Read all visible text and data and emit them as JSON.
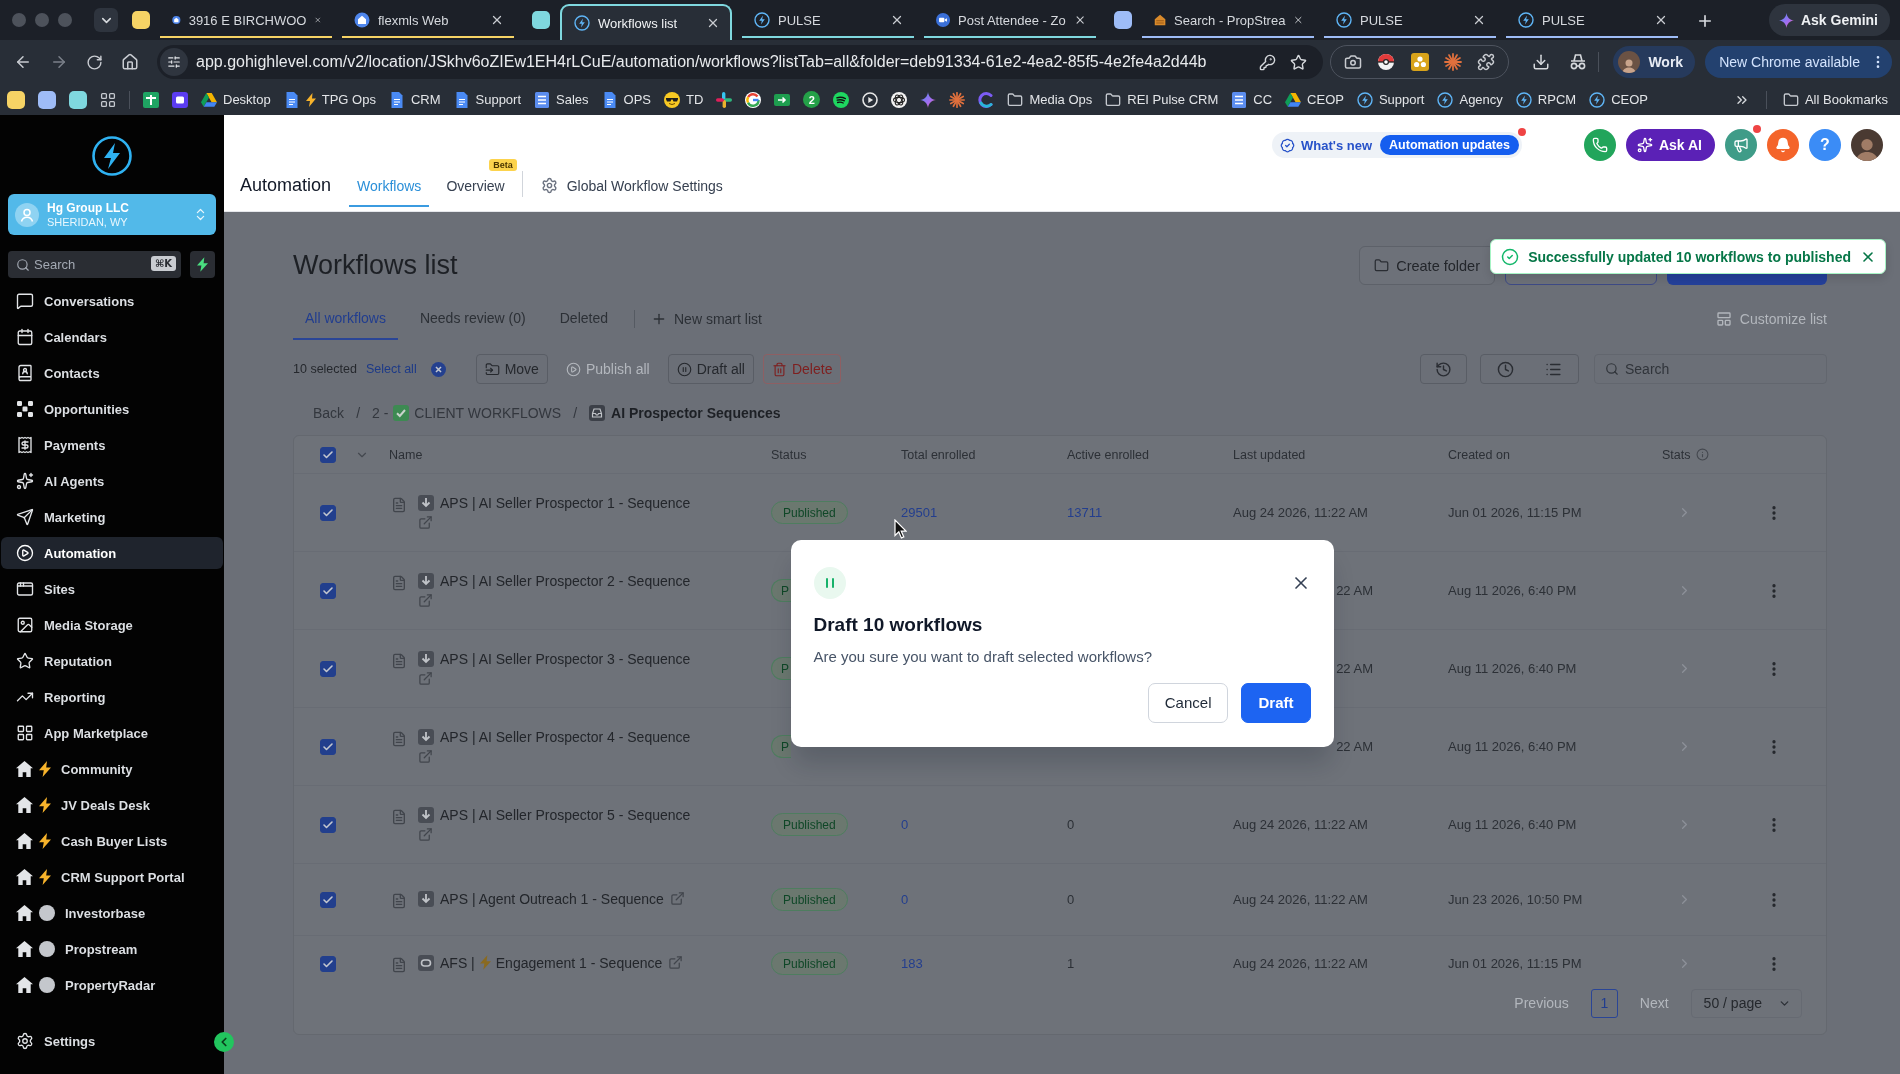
{
  "browser": {
    "tab_groups": [
      {
        "color": "#f6d365",
        "tabs": [
          {
            "kind": "pin",
            "title": "3916 E BIRCHWOO",
            "selected": false
          },
          {
            "kind": "pin",
            "title": "flexmls Web",
            "selected": false
          }
        ]
      },
      {
        "color": "#7fd8df",
        "tabs": [
          {
            "kind": "bolt",
            "title": "Workflows list",
            "selected": true
          },
          {
            "kind": "bolt",
            "title": "PULSE",
            "selected": false
          },
          {
            "kind": "round",
            "title": "Post Attendee - Zo",
            "selected": false
          }
        ]
      },
      {
        "color": "#9ebcf7",
        "tabs": [
          {
            "kind": "hut",
            "title": "Search - PropStrea",
            "selected": false
          },
          {
            "kind": "bolt",
            "title": "PULSE",
            "selected": false
          },
          {
            "kind": "bolt",
            "title": "PULSE",
            "selected": false
          }
        ]
      }
    ],
    "gemini_button": "Ask Gemini",
    "url": "app.gohighlevel.com/v2/location/JSkhv6oZIEw1EH4rLCuE/automation/workflows?listTab=all&folder=deb91334-61e2-4ea2-85f5-4e2fe4a2d44b",
    "profile": "Work",
    "update_button": "New Chrome available",
    "bookmarks": [
      {
        "kind": "tile",
        "color": "#f6d365"
      },
      {
        "kind": "tile",
        "color": "#9ebcf7"
      },
      {
        "kind": "tile",
        "color": "#7fd8df"
      },
      {
        "kind": "grid"
      },
      {
        "kind": "divider"
      },
      {
        "kind": "plus-tile"
      },
      {
        "kind": "app-tile"
      },
      {
        "kind": "drive",
        "label": "Desktop"
      },
      {
        "kind": "doc",
        "label": "TPG Ops",
        "bolt": true
      },
      {
        "kind": "doc",
        "label": "CRM"
      },
      {
        "kind": "doc",
        "label": "Support"
      },
      {
        "kind": "sheet",
        "label": "Sales"
      },
      {
        "kind": "doc",
        "label": "OPS"
      },
      {
        "kind": "shades",
        "label": "TD"
      },
      {
        "kind": "pinwheel"
      },
      {
        "kind": "ring"
      },
      {
        "kind": "arrow-card"
      },
      {
        "kind": "count",
        "label": "2"
      },
      {
        "kind": "waves"
      },
      {
        "kind": "play"
      },
      {
        "kind": "knot"
      },
      {
        "kind": "sparkle"
      },
      {
        "kind": "sunburst"
      },
      {
        "kind": "crescent"
      },
      {
        "kind": "folder",
        "label": "Media Ops"
      },
      {
        "kind": "folder",
        "label": "REI Pulse CRM"
      },
      {
        "kind": "sheet",
        "label": "CC"
      },
      {
        "kind": "drive",
        "label": "CEOP"
      },
      {
        "kind": "bolt",
        "label": "Support"
      },
      {
        "kind": "bolt",
        "label": "Agency"
      },
      {
        "kind": "bolt",
        "label": "RPCM"
      },
      {
        "kind": "bolt",
        "label": "CEOP"
      }
    ],
    "all_bookmarks": "All Bookmarks"
  },
  "sidebar": {
    "account": {
      "name": "Hg Group LLC",
      "location": "SHERIDAN, WY"
    },
    "search": {
      "placeholder": "Search",
      "shortcut": "⌘K"
    },
    "items": [
      {
        "kind": "chat",
        "label": "Conversations",
        "selected": false
      },
      {
        "kind": "calendar",
        "label": "Calendars",
        "selected": false
      },
      {
        "kind": "contacts",
        "label": "Contacts",
        "selected": false
      },
      {
        "kind": "pipeline",
        "label": "Opportunities",
        "selected": false
      },
      {
        "kind": "payments",
        "label": "Payments",
        "selected": false
      },
      {
        "kind": "agents",
        "label": "AI Agents",
        "selected": false
      },
      {
        "kind": "marketing",
        "label": "Marketing",
        "selected": false
      },
      {
        "kind": "automation",
        "label": "Automation",
        "selected": true
      },
      {
        "kind": "sites",
        "label": "Sites",
        "selected": false
      },
      {
        "kind": "media",
        "label": "Media Storage",
        "selected": false
      },
      {
        "kind": "reputation",
        "label": "Reputation",
        "selected": false
      },
      {
        "kind": "reporting",
        "label": "Reporting",
        "selected": false
      },
      {
        "kind": "apps",
        "label": "App Marketplace",
        "selected": false
      },
      {
        "kind": "home-bolt",
        "label": "Community",
        "selected": false
      },
      {
        "kind": "home-bolt",
        "label": "JV Deals Desk",
        "selected": false
      },
      {
        "kind": "home-bolt",
        "label": "Cash Buyer Lists",
        "selected": false
      },
      {
        "kind": "home-bolt",
        "label": "CRM Support Portal",
        "selected": false
      },
      {
        "kind": "home-disc",
        "label": "Investorbase",
        "selected": false
      },
      {
        "kind": "home-disc",
        "label": "Propstream",
        "selected": false
      },
      {
        "kind": "home-disc",
        "label": "PropertyRadar",
        "selected": false
      }
    ],
    "settings": "Settings"
  },
  "header": {
    "title": "Automation",
    "tabs": [
      {
        "label": "Workflows",
        "selected": true
      },
      {
        "label": "Overview",
        "selected": false,
        "badge": "Beta"
      }
    ],
    "settings_link": "Global Workflow Settings",
    "whats_new": "What's new",
    "updates": {
      "label": "Automation updates",
      "unread": true
    },
    "ask_ai": "Ask AI",
    "announcements_unread": true,
    "help": "?"
  },
  "page": {
    "title": "Workflows list",
    "create_folder": "Create folder",
    "toast": {
      "message": "Successfully updated 10 workflows to published"
    },
    "list_tabs": [
      {
        "label": "All workflows",
        "selected": true
      },
      {
        "label": "Needs review (0)",
        "selected": false
      },
      {
        "label": "Deleted",
        "selected": false
      }
    ],
    "new_list": "New smart list",
    "customize": {
      "label": "Customize list",
      "disabled": true
    },
    "selection": {
      "count": "10 selected",
      "select_all": "Select all"
    },
    "bulk_actions": [
      {
        "kind": "move",
        "label": "Move",
        "disabled": false
      },
      {
        "kind": "publish",
        "label": "Publish all",
        "disabled": true
      },
      {
        "kind": "draft",
        "label": "Draft all",
        "disabled": false
      },
      {
        "kind": "delete",
        "label": "Delete",
        "disabled": false
      }
    ],
    "search": {
      "placeholder": "Search"
    },
    "breadcrumb": [
      {
        "kind": "link",
        "text": [
          "Back"
        ]
      },
      {
        "kind": "separator",
        "text": [
          "/"
        ]
      },
      {
        "kind": "link",
        "text": [
          "2 -",
          "CLIENT WORKFLOWS"
        ]
      },
      {
        "kind": "separator",
        "text": [
          "/"
        ]
      },
      {
        "kind": "current",
        "text": [
          "AI Prospector Sequences"
        ]
      }
    ]
  },
  "table": {
    "all_selected": true,
    "columns": [
      "Name",
      "Status",
      "Total enrolled",
      "Active enrolled",
      "Last updated",
      "Created on",
      "Stats"
    ],
    "rows": [
      {
        "kind": "arrow",
        "selected": true,
        "name": [
          "APS | AI Seller Prospector 1 - Sequence"
        ],
        "status": {
          "text": "Published",
          "clipped": false
        },
        "total": {
          "text": "29501",
          "link": true
        },
        "active": {
          "text": "13711",
          "link": true
        },
        "last_updated": {
          "text": "Aug 24 2026, 11:22 AM",
          "clipped": false
        },
        "created": "Jun 01 2026, 11:15 PM"
      },
      {
        "kind": "arrow",
        "selected": true,
        "name": [
          "APS | AI Seller Prospector 2 - Sequence"
        ],
        "status": {
          "text": "P",
          "clipped": true
        },
        "last_updated": {
          "text": "22 AM",
          "clipped": true
        },
        "created": "Aug 11 2026, 6:40 PM"
      },
      {
        "kind": "arrow",
        "selected": true,
        "name": [
          "APS | AI Seller Prospector 3 - Sequence"
        ],
        "status": {
          "text": "P",
          "clipped": true
        },
        "last_updated": {
          "text": "22 AM",
          "clipped": true
        },
        "created": "Aug 11 2026, 6:40 PM"
      },
      {
        "kind": "arrow",
        "selected": true,
        "name": [
          "APS | AI Seller Prospector 4 - Sequence"
        ],
        "status": {
          "text": "P",
          "clipped": true
        },
        "last_updated": {
          "text": "22 AM",
          "clipped": true
        },
        "created": "Aug 11 2026, 6:40 PM"
      },
      {
        "kind": "arrow",
        "selected": true,
        "name": [
          "APS | AI Seller Prospector 5 - Sequence"
        ],
        "status": {
          "text": "Published",
          "clipped": false
        },
        "total": {
          "text": "0",
          "link": true
        },
        "active": {
          "text": "0",
          "link": false
        },
        "last_updated": {
          "text": "Aug 24 2026, 11:22 AM",
          "clipped": false
        },
        "created": "Aug 11 2026, 6:40 PM"
      },
      {
        "kind": "arrow",
        "selected": true,
        "name": [
          "APS | Agent Outreach 1 - Sequence"
        ],
        "status": {
          "text": "Published",
          "clipped": false
        },
        "total": {
          "text": "0",
          "link": true
        },
        "active": {
          "text": "0",
          "link": false
        },
        "last_updated": {
          "text": "Aug 24 2026, 11:22 AM",
          "clipped": false
        },
        "created": "Jun 23 2026, 10:50 PM"
      },
      {
        "kind": "loop",
        "selected": true,
        "name": [
          "AFS |",
          "Engagement 1 - Sequence"
        ],
        "status": {
          "text": "Published",
          "clipped": false
        },
        "total": {
          "text": "183",
          "link": true
        },
        "active": {
          "text": "1",
          "link": false
        },
        "last_updated": {
          "text": "Aug 24 2026, 11:22 AM",
          "clipped": false
        },
        "created": "Jun 01 2026, 11:15 PM"
      }
    ]
  },
  "pagination": {
    "previous": {
      "label": "Previous",
      "disabled": true
    },
    "pages": [
      {
        "label": "1",
        "selected": true
      }
    ],
    "next": {
      "label": "Next",
      "disabled": true
    },
    "page_size": "50 / page"
  },
  "dialog": {
    "title": "Draft 10 workflows",
    "message": "Are you sure you want to draft selected workflows?",
    "buttons": [
      {
        "kind": "secondary",
        "label": "Cancel"
      },
      {
        "kind": "primary",
        "label": "Draft"
      }
    ]
  }
}
